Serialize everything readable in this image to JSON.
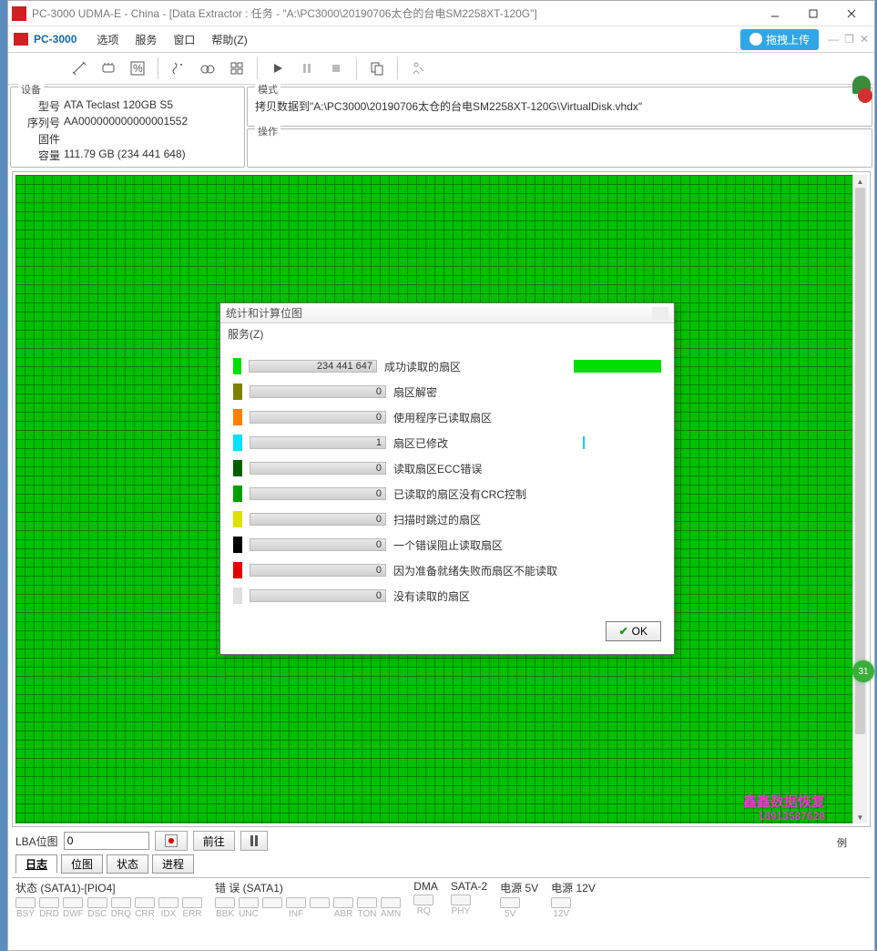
{
  "titlebar": {
    "title": "PC-3000 UDMA-E - China - [Data Extractor : 任务 - \"A:\\PC3000\\20190706太仓的台电SM2258XT-120G\"]"
  },
  "menubar": {
    "brand": "PC-3000",
    "items": [
      "选项",
      "服务",
      "窗口",
      "帮助(Z)"
    ],
    "cloud_upload": "拖拽上传"
  },
  "device_panel": {
    "legend": "设备",
    "model_k": "型号",
    "model_v": "ATA Teclast 120GB S5",
    "serial_k": "序列号",
    "serial_v": "AA000000000000001552",
    "firmware_k": "固件",
    "firmware_v": "",
    "capacity_k": "容量",
    "capacity_v": "111.79 GB (234 441 648)"
  },
  "mode_panel": {
    "legend": "模式",
    "line": "拷贝数据到\"A:\\PC3000\\20190706太仓的台电SM2258XT-120G\\VirtualDisk.vhdx\""
  },
  "op_panel": {
    "legend": "操作"
  },
  "lba": {
    "label": "LBA位图",
    "value": "0",
    "goto": "前往"
  },
  "tabs": [
    "日志",
    "位图",
    "状态",
    "进程"
  ],
  "active_tab": 0,
  "example_btn": "例",
  "status_groups": [
    {
      "title": "状态 (SATA1)-[PIO4]",
      "leds": [
        "BSY",
        "DRD",
        "DWF",
        "DSC",
        "DRQ",
        "CRR",
        "IDX",
        "ERR"
      ]
    },
    {
      "title": "错 误 (SATA1)",
      "leds": [
        "BBK",
        "UNC",
        "",
        "INF",
        "",
        "ABR",
        "TON",
        "AMN"
      ]
    },
    {
      "title": "DMA",
      "leds": [
        "RQ"
      ]
    },
    {
      "title": "SATA-2",
      "leds": [
        "PHY"
      ]
    },
    {
      "title": "电源 5V",
      "leds": [
        "5V"
      ]
    },
    {
      "title": "电源 12V",
      "leds": [
        "12V"
      ]
    }
  ],
  "dialog": {
    "title": "统计和计算位图",
    "menu": "服务(Z)",
    "ok": "OK",
    "stats": [
      {
        "color": "#00e000",
        "value": "234 441 647",
        "label": "成功读取的扇区",
        "vis_color": "#00e000",
        "vis_width": 96
      },
      {
        "color": "#808000",
        "value": "0",
        "label": "扇区解密",
        "vis_color": "",
        "vis_width": 0
      },
      {
        "color": "#ff8000",
        "value": "0",
        "label": "使用程序已读取扇区",
        "vis_color": "",
        "vis_width": 0
      },
      {
        "color": "#00e0ff",
        "value": "1",
        "label": "扇区已修改",
        "vis_color": "#00d0ff",
        "vis_width": 2
      },
      {
        "color": "#006000",
        "value": "0",
        "label": "读取扇区ECC错误",
        "vis_color": "",
        "vis_width": 0
      },
      {
        "color": "#00a000",
        "value": "0",
        "label": "已读取的扇区没有CRC控制",
        "vis_color": "",
        "vis_width": 0
      },
      {
        "color": "#e0e000",
        "value": "0",
        "label": "扫描时跳过的扇区",
        "vis_color": "",
        "vis_width": 0
      },
      {
        "color": "#000000",
        "value": "0",
        "label": "一个错误阻止读取扇区",
        "vis_color": "",
        "vis_width": 0
      },
      {
        "color": "#e00000",
        "value": "0",
        "label": "因为准备就绪失败而扇区不能读取",
        "vis_color": "",
        "vis_width": 0
      },
      {
        "color": "#e0e0e0",
        "value": "0",
        "label": "没有读取的扇区",
        "vis_color": "",
        "vis_width": 0
      }
    ]
  },
  "watermark": {
    "line1": "鑫鑫数据恢复",
    "line2": "18913587628"
  },
  "badge": "31"
}
